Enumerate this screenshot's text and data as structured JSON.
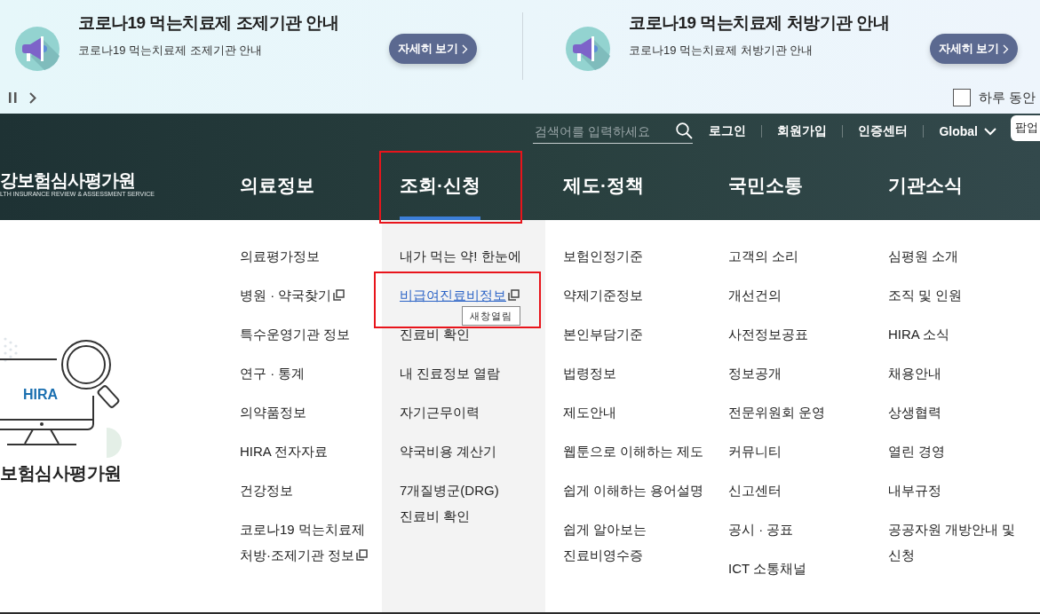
{
  "notices": [
    {
      "title": "코로나19 먹는치료제 조제기관 안내",
      "subtitle": "코로나19 먹는치료제 조제기관 안내",
      "button": "자세히 보기"
    },
    {
      "title": "코로나19 먹는치료제 처방기관 안내",
      "subtitle": "코로나19 먹는치료제 처방기관 안내",
      "button": "자세히 보기"
    }
  ],
  "hide_today": {
    "label": "하루 동안",
    "checked": false
  },
  "header": {
    "logo": {
      "name": "강보험심사평가원",
      "subtitle": "LTH INSURANCE REVIEW & ASSESSMENT SERVICE"
    },
    "search": {
      "placeholder": "검색어를 입력하세요"
    },
    "links": [
      "로그인",
      "회원가입",
      "인증센터",
      "Global"
    ],
    "popup_tab": "팝업",
    "nav": [
      {
        "label": "의료정보",
        "selected": false,
        "highlighted": false
      },
      {
        "label": "조회·신청",
        "selected": true,
        "highlighted": true
      },
      {
        "label": "제도·정책",
        "selected": false,
        "highlighted": false
      },
      {
        "label": "국민소통",
        "selected": false,
        "highlighted": false
      },
      {
        "label": "기관소식",
        "selected": false,
        "highlighted": false
      }
    ]
  },
  "menu": {
    "illustration": {
      "screen_text": "HIRA",
      "caption": "보험심사평가원"
    },
    "columns": [
      {
        "items": [
          {
            "label": "의료평가정보",
            "new_window": false,
            "hovered": false,
            "highlighted": false
          },
          {
            "label": "병원 · 약국찾기",
            "new_window": true,
            "hovered": false,
            "highlighted": false
          },
          {
            "label": "특수운영기관 정보",
            "new_window": false,
            "hovered": false,
            "highlighted": false
          },
          {
            "label": "연구 · 통계",
            "new_window": false,
            "hovered": false,
            "highlighted": false
          },
          {
            "label": "의약품정보",
            "new_window": false,
            "hovered": false,
            "highlighted": false
          },
          {
            "label": "HIRA 전자자료",
            "new_window": false,
            "hovered": false,
            "highlighted": false
          },
          {
            "label": "건강정보",
            "new_window": false,
            "hovered": false,
            "highlighted": false
          },
          {
            "label": "코로나19 먹는치료제 처방·조제기관 정보",
            "new_window": true,
            "hovered": false,
            "highlighted": false
          }
        ]
      },
      {
        "items": [
          {
            "label": "내가 먹는 약! 한눈에",
            "new_window": false,
            "hovered": false,
            "highlighted": false
          },
          {
            "label": "비급여진료비정보",
            "new_window": true,
            "hovered": true,
            "highlighted": true,
            "tooltip": "새창열림"
          },
          {
            "label": "진료비 확인",
            "new_window": false,
            "hovered": false,
            "highlighted": false
          },
          {
            "label": "내 진료정보 열람",
            "new_window": false,
            "hovered": false,
            "highlighted": false
          },
          {
            "label": "자기근무이력",
            "new_window": false,
            "hovered": false,
            "highlighted": false
          },
          {
            "label": "약국비용 계산기",
            "new_window": false,
            "hovered": false,
            "highlighted": false
          },
          {
            "label": "7개질병군(DRG) 진료비 확인",
            "new_window": false,
            "hovered": false,
            "highlighted": false
          }
        ]
      },
      {
        "items": [
          {
            "label": "보험인정기준",
            "new_window": false,
            "hovered": false,
            "highlighted": false
          },
          {
            "label": "약제기준정보",
            "new_window": false,
            "hovered": false,
            "highlighted": false
          },
          {
            "label": "본인부담기준",
            "new_window": false,
            "hovered": false,
            "highlighted": false
          },
          {
            "label": "법령정보",
            "new_window": false,
            "hovered": false,
            "highlighted": false
          },
          {
            "label": "제도안내",
            "new_window": false,
            "hovered": false,
            "highlighted": false
          },
          {
            "label": "웹툰으로 이해하는 제도",
            "new_window": false,
            "hovered": false,
            "highlighted": false
          },
          {
            "label": "쉽게 이해하는 용어설명",
            "new_window": false,
            "hovered": false,
            "highlighted": false
          },
          {
            "label": "쉽게 알아보는 진료비영수증",
            "new_window": false,
            "hovered": false,
            "highlighted": false
          }
        ]
      },
      {
        "items": [
          {
            "label": "고객의 소리",
            "new_window": false,
            "hovered": false,
            "highlighted": false
          },
          {
            "label": "개선건의",
            "new_window": false,
            "hovered": false,
            "highlighted": false
          },
          {
            "label": "사전정보공표",
            "new_window": false,
            "hovered": false,
            "highlighted": false
          },
          {
            "label": "정보공개",
            "new_window": false,
            "hovered": false,
            "highlighted": false
          },
          {
            "label": "전문위원회 운영",
            "new_window": false,
            "hovered": false,
            "highlighted": false
          },
          {
            "label": "커뮤니티",
            "new_window": false,
            "hovered": false,
            "highlighted": false
          },
          {
            "label": "신고센터",
            "new_window": false,
            "hovered": false,
            "highlighted": false
          },
          {
            "label": "공시 · 공표",
            "new_window": false,
            "hovered": false,
            "highlighted": false
          },
          {
            "label": "ICT 소통채널",
            "new_window": false,
            "hovered": false,
            "highlighted": false
          }
        ]
      },
      {
        "items": [
          {
            "label": "심평원 소개",
            "new_window": false,
            "hovered": false,
            "highlighted": false
          },
          {
            "label": "조직 및 인원",
            "new_window": false,
            "hovered": false,
            "highlighted": false
          },
          {
            "label": "HIRA 소식",
            "new_window": false,
            "hovered": false,
            "highlighted": false
          },
          {
            "label": "채용안내",
            "new_window": false,
            "hovered": false,
            "highlighted": false
          },
          {
            "label": "상생협력",
            "new_window": false,
            "hovered": false,
            "highlighted": false
          },
          {
            "label": "열린 경영",
            "new_window": false,
            "hovered": false,
            "highlighted": false
          },
          {
            "label": "내부규정",
            "new_window": false,
            "hovered": false,
            "highlighted": false
          },
          {
            "label": "공공자원 개방안내 및 신청",
            "new_window": false,
            "hovered": false,
            "highlighted": false
          }
        ]
      }
    ]
  }
}
